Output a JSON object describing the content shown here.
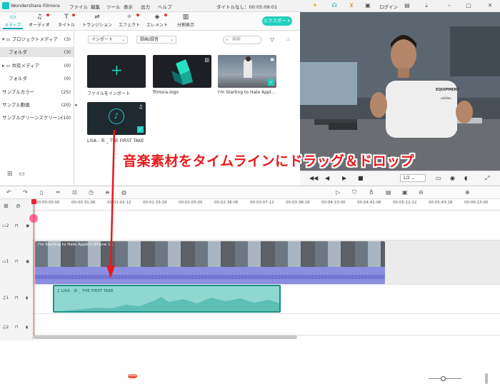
{
  "app": {
    "name": "Wondershare Filmora",
    "menu": [
      "ファイル",
      "編集",
      "ツール",
      "表示",
      "出力",
      "ヘルプ"
    ],
    "title": "タイトルなし：00:05:09:01",
    "login": "ログイン"
  },
  "toolbar": {
    "tabs": [
      "メディア",
      "オーディオ",
      "タイトル",
      "トランジション",
      "エフェクト",
      "エレメント",
      "分割表示"
    ],
    "export": "エクスポート"
  },
  "sidebar": {
    "items": [
      {
        "label": "プロジェクトメディア",
        "count": "(3)"
      },
      {
        "label": "フォルダ",
        "count": "(3)"
      },
      {
        "label": "共有メディア",
        "count": "(0)"
      },
      {
        "label": "フォルダ",
        "count": "(0)"
      },
      {
        "label": "サンプルカラー",
        "count": "(25)"
      },
      {
        "label": "サンプル動画",
        "count": "(20)"
      },
      {
        "label": "サンプルグリーンスクリーン",
        "count": "(10)"
      }
    ]
  },
  "media": {
    "import_dropdown": "インポート",
    "record_dropdown": "録画/録音",
    "search_placeholder": "検索",
    "items": [
      "ファイルをインポート",
      "filmora-logo",
      "I'm Starting to Hate Appl...",
      "LiSA - 炎 _ THE FIRST TAKE"
    ]
  },
  "preview": {
    "speed": "1/2",
    "shirt_text": "EQUIPMENT",
    "shirt_text2": "adidas"
  },
  "timeline": {
    "beta": "Beta",
    "ticks": [
      "00:00:00:00",
      "00:00:31:06",
      "00:01:02:12",
      "00:01:33:18",
      "00:02:05:00",
      "00:02:36:06",
      "00:03:07:12",
      "00:03:38:18",
      "00:04:10:00",
      "00:04:41:06",
      "00:05:12:12",
      "00:05:43:18",
      "00:06:15:00"
    ],
    "tracks": [
      "2",
      "1",
      "1",
      "2"
    ],
    "video_clip": "I'm Starting to Hate Apple's iPhone 15",
    "audio_clip": "LiSA - 炎 _ THE FIRST TAKE"
  },
  "annotation": "音楽素材をタイムラインにドラッグ＆ドロップ",
  "colors": {
    "accent": "#21cfbd",
    "arrow": "#e8191c",
    "video_clip": "#8c8fe0",
    "audio_clip": "#8fd8cf"
  }
}
